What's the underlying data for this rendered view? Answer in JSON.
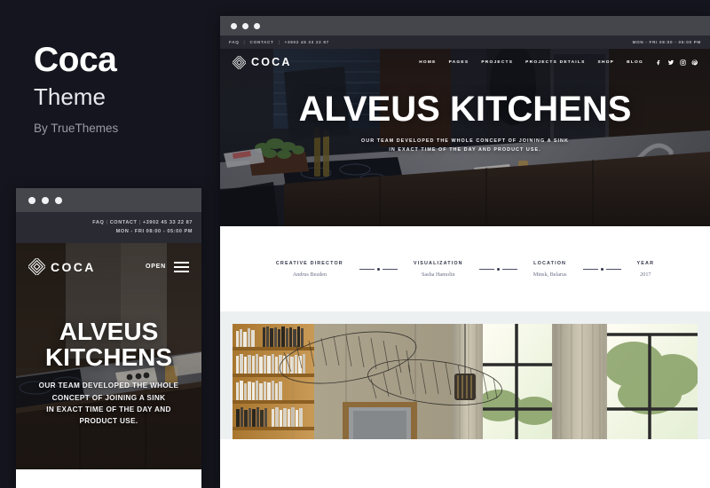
{
  "promo": {
    "title": "Coca",
    "subtitle": "Theme",
    "author": "By TrueThemes"
  },
  "colors": {
    "page_background": "#15151f",
    "chrome_bar": "#45454c",
    "utility_bar": "#282830",
    "gallery_band": "#ecf0f1",
    "meta_label": "#33364a",
    "meta_value": "#6b6f85"
  },
  "desktop": {
    "window_dots": [
      "dot",
      "dot",
      "dot"
    ],
    "utility_bar": {
      "faq": "FAQ",
      "contact": "CONTACT",
      "phone": "+3902 45 33 22 87",
      "separator": "|",
      "hours": "MON - FRI 08:00 - 05:00 PM"
    },
    "nav": {
      "brand": "COCA",
      "links": [
        "HOME",
        "PAGES",
        "PROJECTS",
        "PROJECTS DETAILS",
        "SHOP",
        "BLOG"
      ],
      "socials": [
        "facebook-icon",
        "twitter-icon",
        "instagram-icon",
        "pinterest-icon"
      ]
    },
    "hero": {
      "title": "ALVEUS KITCHENS",
      "subtitle_line1": "OUR TEAM DEVELOPED THE WHOLE CONCEPT OF JOINING A SINK",
      "subtitle_line2": "IN EXACT TIME OF THE DAY AND PRODUCT USE."
    },
    "meta": [
      {
        "label": "CREATIVE DIRECTOR",
        "value": "Andrus Bezden"
      },
      {
        "label": "VISUALIZATION",
        "value": "Sasha Hamolin"
      },
      {
        "label": "LOCATION",
        "value": "Minsk, Belarus"
      },
      {
        "label": "YEAR",
        "value": "2017"
      }
    ]
  },
  "mobile": {
    "window_dots": [
      "dot",
      "dot",
      "dot"
    ],
    "utility_bar": {
      "faq": "FAQ",
      "contact": "CONTACT",
      "phone": "+3902 45 33 22 87",
      "separator": "|",
      "hours": "MON - FRI 08:00 - 05:00 PM"
    },
    "nav": {
      "brand": "COCA",
      "open_label": "OPEN",
      "menu_icon": "hamburger-icon"
    },
    "hero": {
      "title_line1": "ALVEUS",
      "title_line2": "KITCHENS",
      "subtitle_line1": "OUR TEAM DEVELOPED THE WHOLE",
      "subtitle_line2": "CONCEPT OF JOINING A SINK",
      "subtitle_line3": "IN EXACT TIME OF THE DAY AND",
      "subtitle_line4": "PRODUCT USE."
    }
  }
}
